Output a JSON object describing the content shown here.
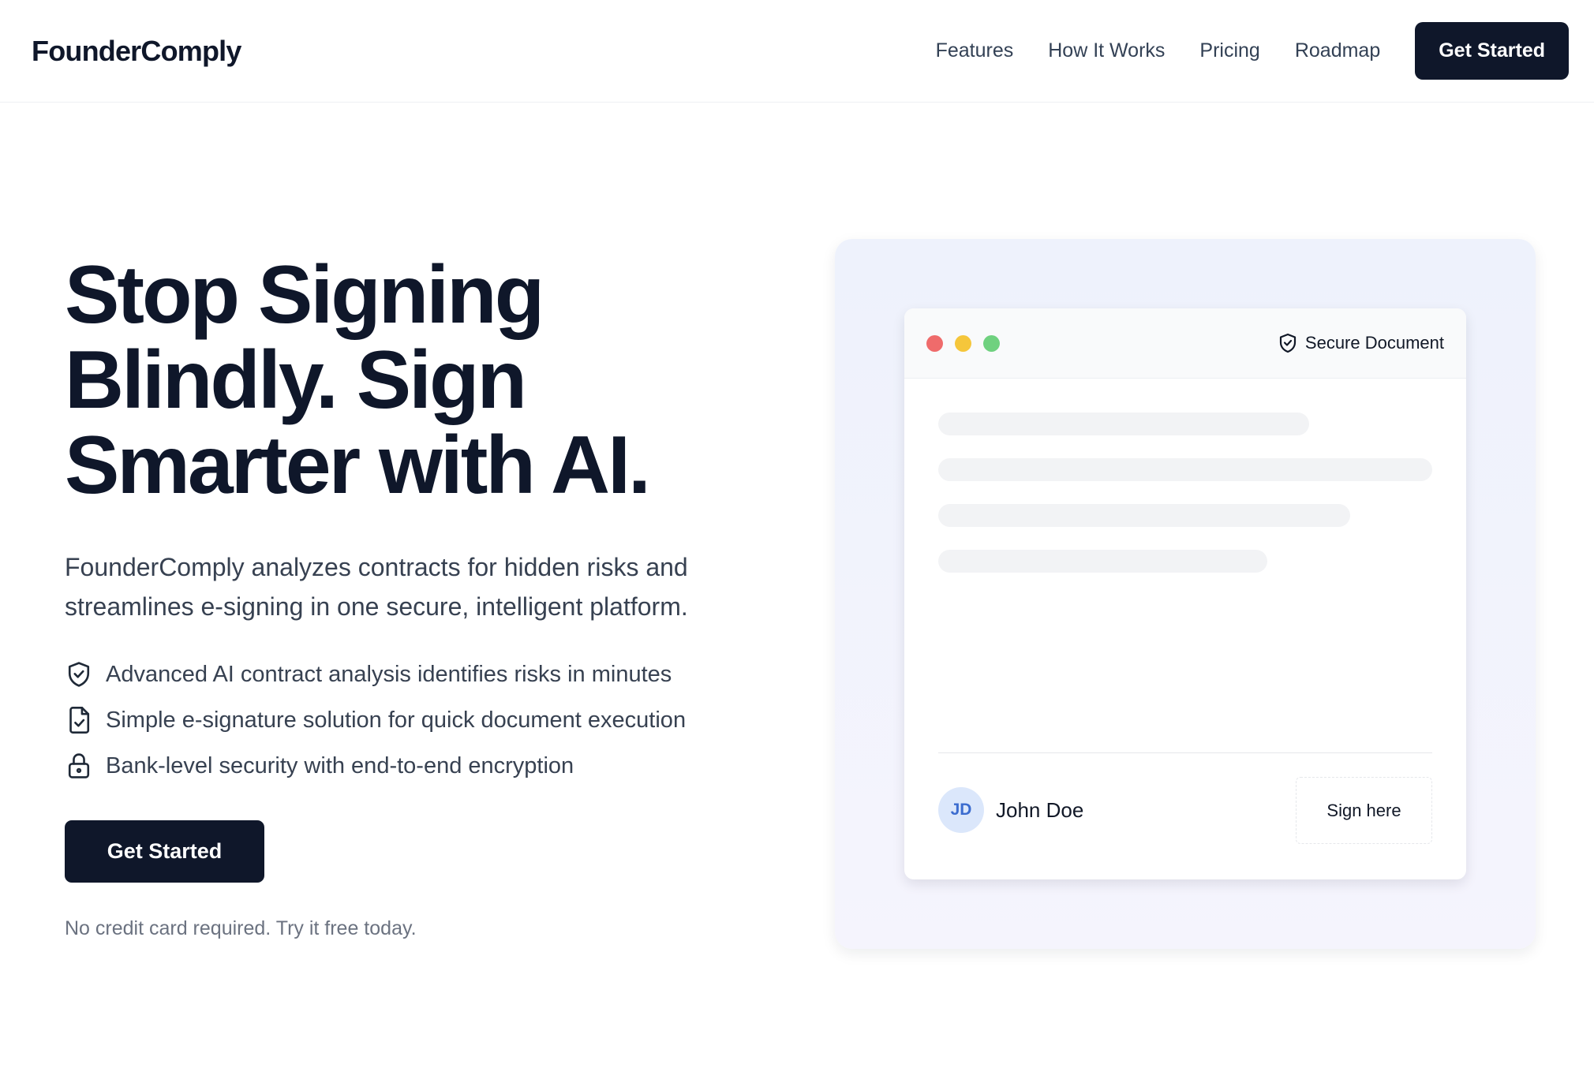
{
  "header": {
    "logo": "FounderComply",
    "nav": [
      {
        "label": "Features"
      },
      {
        "label": "How It Works"
      },
      {
        "label": "Pricing"
      },
      {
        "label": "Roadmap"
      }
    ],
    "cta_label": "Get Started"
  },
  "hero": {
    "title_lines": [
      "Stop Signing",
      "Blindly. Sign",
      "Smarter with AI."
    ],
    "subtitle_lines": [
      "FounderComply analyzes contracts for hidden risks and",
      "streamlines e-signing in one secure, intelligent platform."
    ],
    "features": [
      {
        "icon": "shield-check-icon",
        "text": "Advanced AI contract analysis identifies risks in minutes"
      },
      {
        "icon": "file-check-icon",
        "text": "Simple e-signature solution for quick document execution"
      },
      {
        "icon": "lock-icon",
        "text": "Bank-level security with end-to-end encryption"
      }
    ],
    "cta_label": "Get Started",
    "note": "No credit card required. Try it free today."
  },
  "preview": {
    "secure_label": "Secure Document",
    "signer": {
      "initials": "JD",
      "name": "John Doe"
    },
    "sign_label": "Sign here"
  },
  "colors": {
    "primary": "#0f172a",
    "text_muted": "#6b7280",
    "avatar_bg": "#dbe7fb",
    "avatar_text": "#3b6ccf",
    "window_red": "#ef6b6b",
    "window_yellow": "#f5c63b",
    "window_green": "#6fd17f"
  }
}
